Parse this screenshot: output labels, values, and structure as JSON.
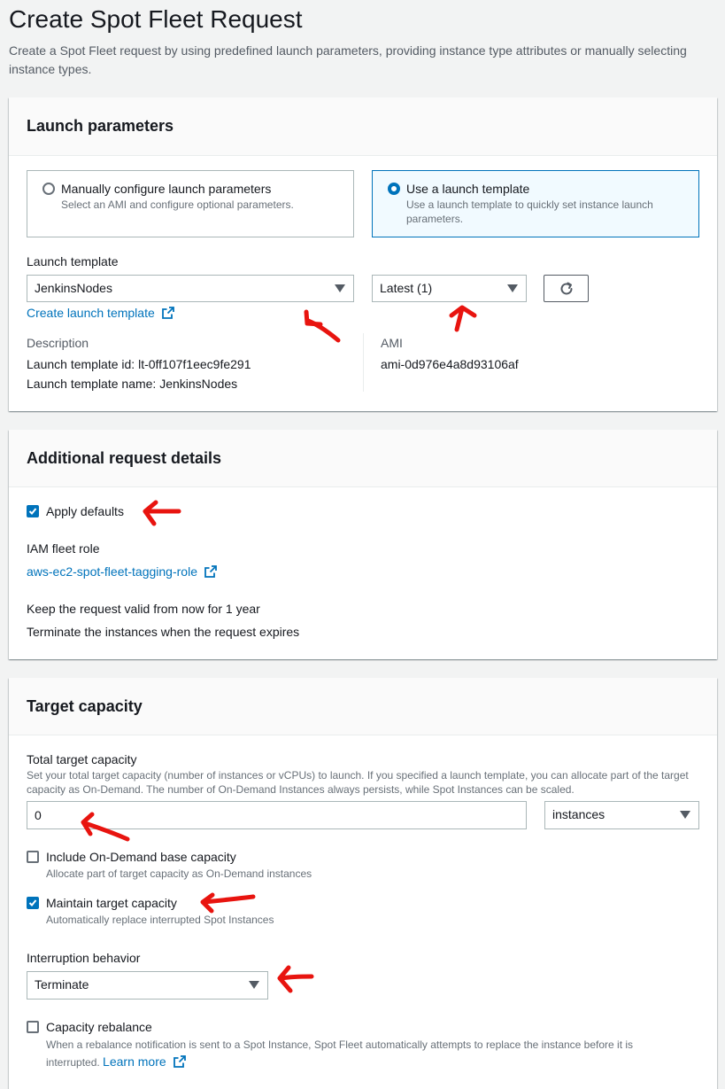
{
  "page": {
    "title": "Create Spot Fleet Request",
    "description": "Create a Spot Fleet request by using predefined launch parameters, providing instance type attributes or manually selecting instance types."
  },
  "launch_parameters": {
    "heading": "Launch parameters",
    "option_manual": {
      "title": "Manually configure launch parameters",
      "description": "Select an AMI and configure optional parameters.",
      "selected": false
    },
    "option_template": {
      "title": "Use a launch template",
      "description": "Use a launch template to quickly set instance launch parameters.",
      "selected": true
    },
    "template_label": "Launch template",
    "template_value": "JenkinsNodes",
    "version_value": "Latest (1)",
    "create_link": "Create launch template",
    "description_label": "Description",
    "template_id_line": "Launch template id: lt-0ff107f1eec9fe291",
    "template_name_line": "Launch template name: JenkinsNodes",
    "ami_label": "AMI",
    "ami_value": "ami-0d976e4a8d93106af"
  },
  "additional_details": {
    "heading": "Additional request details",
    "apply_defaults_label": "Apply defaults",
    "apply_defaults_checked": true,
    "iam_role_label": "IAM fleet role",
    "iam_role_link": "aws-ec2-spot-fleet-tagging-role",
    "validity_text": "Keep the request valid from now for 1 year",
    "terminate_text": "Terminate the instances when the request expires"
  },
  "target_capacity": {
    "heading": "Target capacity",
    "total_label": "Total target capacity",
    "total_description": "Set your total target capacity (number of instances or vCPUs) to launch. If you specified a launch template, you can allocate part of the target capacity as On-Demand. The number of On-Demand Instances always persists, while Spot Instances can be scaled.",
    "total_value": "0",
    "unit_value": "instances",
    "ondemand_label": "Include On-Demand base capacity",
    "ondemand_description": "Allocate part of target capacity as On-Demand instances",
    "ondemand_checked": false,
    "maintain_label": "Maintain target capacity",
    "maintain_description": "Automatically replace interrupted Spot Instances",
    "maintain_checked": true,
    "interruption_label": "Interruption behavior",
    "interruption_value": "Terminate",
    "rebalance_label": "Capacity rebalance",
    "rebalance_description": "When a rebalance notification is sent to a Spot Instance, Spot Fleet automatically attempts to replace the instance before it is interrupted.",
    "rebalance_link": "Learn more",
    "rebalance_checked": false
  },
  "icons": {
    "external": "external-link-icon",
    "refresh": "refresh-icon",
    "caret": "caret-down-icon",
    "annotation": "red-arrow-annotation"
  },
  "colors": {
    "accent": "#0073bb",
    "annotation": "#e8140f",
    "background": "#f2f3f3"
  }
}
